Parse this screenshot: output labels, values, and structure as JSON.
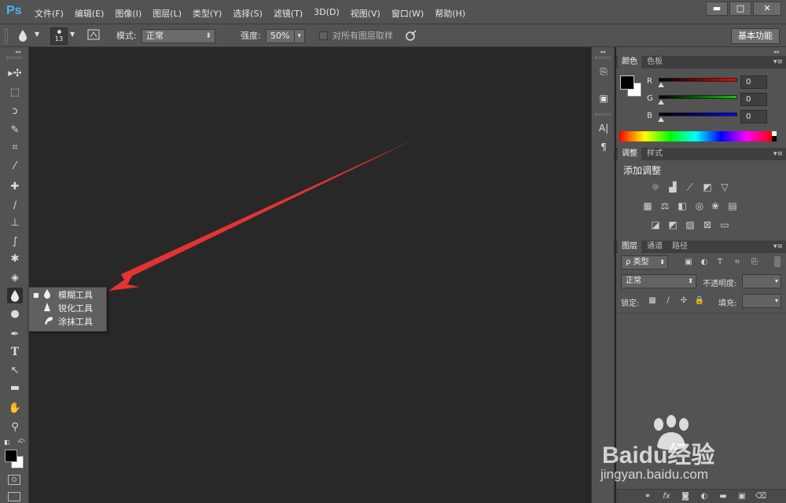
{
  "app": {
    "logo": "Ps"
  },
  "menu": [
    "文件(F)",
    "编辑(E)",
    "图像(I)",
    "图层(L)",
    "类型(Y)",
    "选择(S)",
    "滤镜(T)",
    "3D(D)",
    "视图(V)",
    "窗口(W)",
    "帮助(H)"
  ],
  "window_controls": {
    "minimize": "▬",
    "maximize": "□",
    "close": "✕"
  },
  "options_bar": {
    "brush_size": "13",
    "mode_label": "模式:",
    "mode_value": "正常",
    "strength_label": "强度:",
    "strength_value": "50%",
    "sample_all_label": "对所有图层取样",
    "workspace": "基本功能"
  },
  "tool_flyout": {
    "items": [
      {
        "label": "模糊工具",
        "selected": true,
        "icon": "blur-drop-icon"
      },
      {
        "label": "锐化工具",
        "selected": false,
        "icon": "sharpen-triangle-icon"
      },
      {
        "label": "涂抹工具",
        "selected": false,
        "icon": "smudge-finger-icon"
      }
    ]
  },
  "color_panel": {
    "tabs": [
      "颜色",
      "色板"
    ],
    "channels": [
      {
        "label": "R",
        "value": "0",
        "color": "#ff0000"
      },
      {
        "label": "G",
        "value": "0",
        "color": "#00cc00"
      },
      {
        "label": "B",
        "value": "0",
        "color": "#0000ff"
      }
    ],
    "foreground": "#000000",
    "background": "#ffffff"
  },
  "adjustments_panel": {
    "tabs": [
      "调整",
      "样式"
    ],
    "title": "添加调整"
  },
  "layers_panel": {
    "tabs": [
      "图层",
      "通道",
      "路径"
    ],
    "filter_label": "ρ 类型",
    "blend_mode": "正常",
    "opacity_label": "不透明度:",
    "lock_label": "锁定:",
    "fill_label": "填充:"
  },
  "watermark": {
    "brand": "Baidu经验",
    "url": "jingyan.baidu.com"
  },
  "annotation": {
    "arrow_color": "#e53333"
  }
}
